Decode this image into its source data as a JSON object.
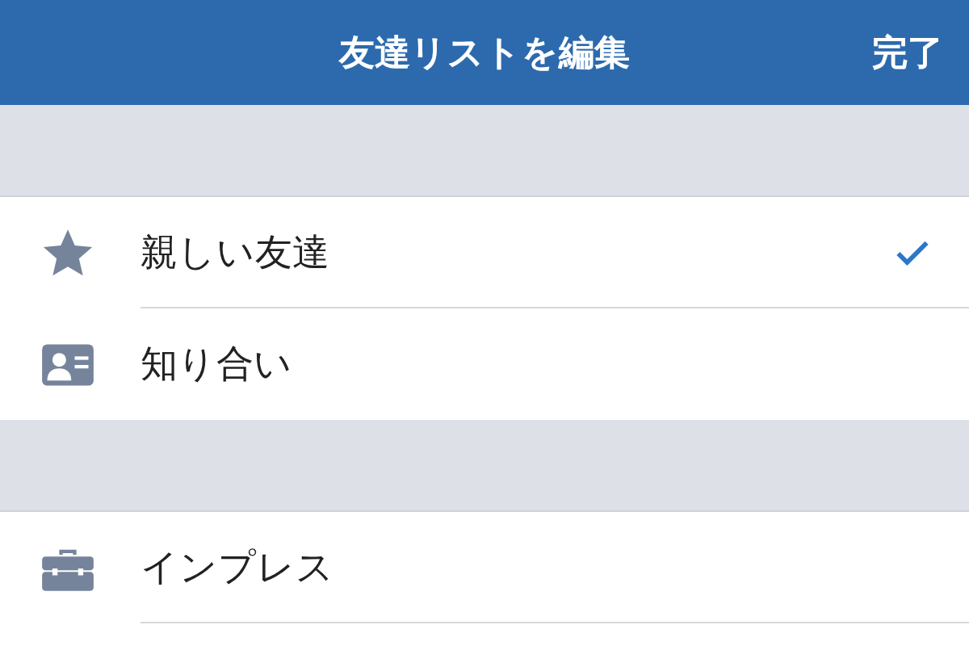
{
  "header": {
    "title": "友達リストを編集",
    "done_button": "完了"
  },
  "sections": [
    {
      "items": [
        {
          "kind": "star",
          "label": "親しい友達",
          "selected": true
        },
        {
          "kind": "card",
          "label": "知り合い",
          "selected": false
        }
      ]
    },
    {
      "items": [
        {
          "kind": "briefcase",
          "label": "インプレス",
          "selected": false
        }
      ]
    }
  ]
}
